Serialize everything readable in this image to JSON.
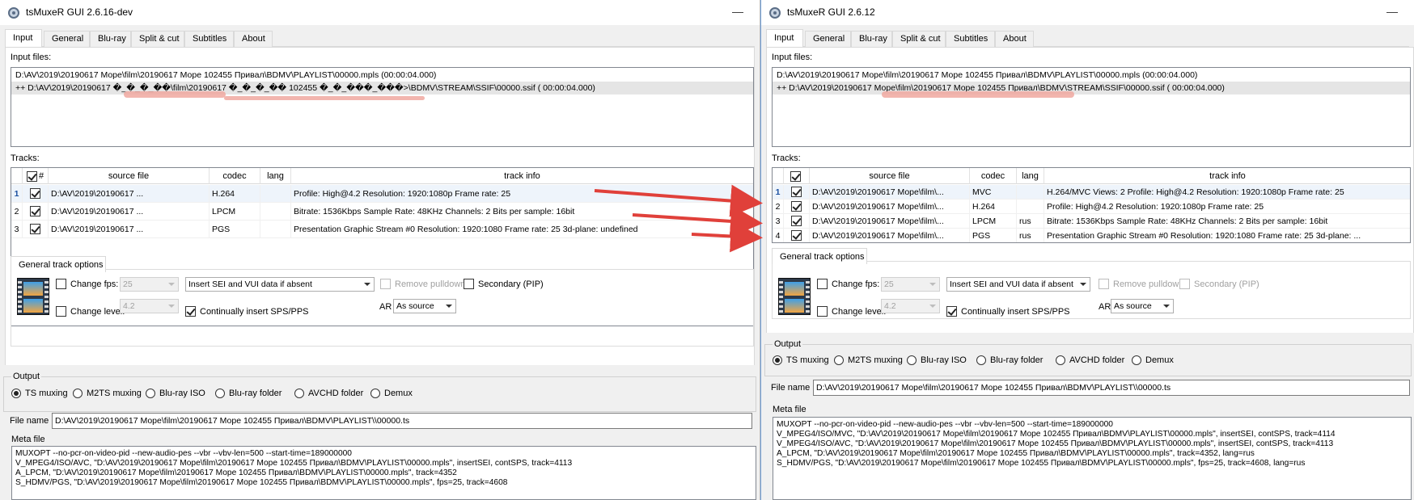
{
  "left": {
    "title": "tsMuxeR GUI 2.6.16-dev",
    "tabs": [
      "Input",
      "General",
      "Blu-ray",
      "Split & cut",
      "Subtitles",
      "About"
    ],
    "input_files_label": "Input files:",
    "input_files": [
      "D:\\AV\\2019\\20190617 Море\\film\\20190617 Море 102455 Привал\\BDMV\\PLAYLIST\\00000.mpls (00:00:04.000)",
      "++ D:\\AV\\2019\\20190617 �_�_�_��\\film\\20190617 �_�_�_�� 102455 �_�_���_���>\\BDMV\\STREAM\\SSIF\\00000.ssif ( 00:00:04.000)"
    ],
    "tracks_label": "Tracks:",
    "track_headers": {
      "check": "#",
      "source": "source file",
      "codec": "codec",
      "lang": "lang",
      "info": "track info"
    },
    "tracks": [
      {
        "num": "1",
        "source": "D:\\AV\\2019\\20190617 ...",
        "codec": "H.264",
        "lang": "",
        "info": "Profile: High@4.2  Resolution: 1920:1080p  Frame rate: 25"
      },
      {
        "num": "2",
        "source": "D:\\AV\\2019\\20190617 ...",
        "codec": "LPCM",
        "lang": "",
        "info": "Bitrate: 1536Kbps  Sample Rate: 48KHz  Channels: 2  Bits per sample: 16bit"
      },
      {
        "num": "3",
        "source": "D:\\AV\\2019\\20190617 ...",
        "codec": "PGS",
        "lang": "",
        "info": "Presentation Graphic Stream #0 Resolution: 1920:1080 Frame rate: 25   3d-plane: undefined"
      }
    ],
    "gto": {
      "title": "General track options",
      "change_fps": "Change fps:",
      "fps_value": "25",
      "sei_value": "Insert SEI and VUI data if absent",
      "remove_pulldown": "Remove pulldown",
      "secondary": "Secondary (PIP)",
      "change_level": "Change level:",
      "level_value": "4.2",
      "continually": "Continually insert SPS/PPS",
      "ar_label": "AR",
      "ar_value": "As source"
    },
    "output": {
      "title": "Output",
      "options": [
        "TS muxing",
        "M2TS muxing",
        "Blu-ray ISO",
        "Blu-ray folder",
        "AVCHD folder",
        "Demux"
      ],
      "file_name_label": "File name",
      "file_name": "D:\\AV\\2019\\20190617 Море\\film\\20190617 Море 102455 Привал\\BDMV\\PLAYLIST\\\\00000.ts"
    },
    "meta_label": "Meta file",
    "meta": [
      "MUXOPT --no-pcr-on-video-pid --new-audio-pes --vbr  --vbv-len=500 --start-time=189000000",
      "V_MPEG4/ISO/AVC, \"D:\\AV\\2019\\20190617 Море\\film\\20190617 Море 102455 Привал\\BDMV\\PLAYLIST\\00000.mpls\", insertSEI, contSPS, track=4113",
      "A_LPCM, \"D:\\AV\\2019\\20190617 Море\\film\\20190617 Море 102455 Привал\\BDMV\\PLAYLIST\\00000.mpls\", track=4352",
      "S_HDMV/PGS, \"D:\\AV\\2019\\20190617 Море\\film\\20190617 Море 102455 Привал\\BDMV\\PLAYLIST\\00000.mpls\", fps=25, track=4608"
    ]
  },
  "right": {
    "title": "tsMuxeR GUI 2.6.12",
    "tabs": [
      "Input",
      "General",
      "Blu-ray",
      "Split & cut",
      "Subtitles",
      "About"
    ],
    "input_files_label": "Input files:",
    "input_files": [
      "D:\\AV\\2019\\20190617 Море\\film\\20190617 Море 102455 Привал\\BDMV\\PLAYLIST\\00000.mpls (00:00:04.000)",
      "++ D:\\AV\\2019\\20190617 Море\\film\\20190617 Море 102455 Привал\\BDMV\\STREAM\\SSIF\\00000.ssif ( 00:00:04.000)"
    ],
    "tracks_label": "Tracks:",
    "track_headers": {
      "check": "",
      "source": "source file",
      "codec": "codec",
      "lang": "lang",
      "info": "track info"
    },
    "tracks": [
      {
        "num": "1",
        "source": "D:\\AV\\2019\\20190617 Море\\film\\...",
        "codec": "MVC",
        "lang": "",
        "info": "H.264/MVC Views: 2 Profile: High@4.2  Resolution: 1920:1080p  Frame rate: 25"
      },
      {
        "num": "2",
        "source": "D:\\AV\\2019\\20190617 Море\\film\\...",
        "codec": "H.264",
        "lang": "",
        "info": "Profile: High@4.2  Resolution: 1920:1080p  Frame rate: 25"
      },
      {
        "num": "3",
        "source": "D:\\AV\\2019\\20190617 Море\\film\\...",
        "codec": "LPCM",
        "lang": "rus",
        "info": "Bitrate: 1536Kbps  Sample Rate: 48KHz  Channels: 2  Bits per sample: 16bit"
      },
      {
        "num": "4",
        "source": "D:\\AV\\2019\\20190617 Море\\film\\...",
        "codec": "PGS",
        "lang": "rus",
        "info": "Presentation Graphic Stream #0 Resolution: 1920:1080 Frame rate: 25   3d-plane: ..."
      }
    ],
    "gto": {
      "title": "General track options",
      "change_fps": "Change fps:",
      "fps_value": "25",
      "sei_value": "Insert SEI and VUI data if absent",
      "remove_pulldown": "Remove pulldown",
      "secondary": "Secondary (PIP)",
      "change_level": "Change level:",
      "level_value": "4.2",
      "continually": "Continually insert SPS/PPS",
      "ar_label": "AR",
      "ar_value": "As source"
    },
    "output": {
      "title": "Output",
      "options": [
        "TS muxing",
        "M2TS muxing",
        "Blu-ray ISO",
        "Blu-ray folder",
        "AVCHD folder",
        "Demux"
      ],
      "file_name_label": "File name",
      "file_name": "D:\\AV\\2019\\20190617 Море\\film\\20190617 Море 102455 Привал\\BDMV\\PLAYLIST\\\\00000.ts"
    },
    "meta_label": "Meta file",
    "meta": [
      "MUXOPT --no-pcr-on-video-pid --new-audio-pes --vbr  --vbv-len=500 --start-time=189000000",
      "V_MPEG4/ISO/MVC, \"D:\\AV\\2019\\20190617 Море\\film\\20190617 Море 102455 Привал\\BDMV\\PLAYLIST\\00000.mpls\", insertSEI, contSPS, track=4114",
      "V_MPEG4/ISO/AVC, \"D:\\AV\\2019\\20190617 Море\\film\\20190617 Море 102455 Привал\\BDMV\\PLAYLIST\\00000.mpls\", insertSEI, contSPS, track=4113",
      "A_LPCM, \"D:\\AV\\2019\\20190617 Море\\film\\20190617 Море 102455 Привал\\BDMV\\PLAYLIST\\00000.mpls\", track=4352, lang=rus",
      "S_HDMV/PGS, \"D:\\AV\\2019\\20190617 Море\\film\\20190617 Море 102455 Привал\\BDMV\\PLAYLIST\\00000.mpls\", fps=25, track=4608, lang=rus"
    ]
  },
  "colors": {
    "annotation_arrow": "#e0403a",
    "highlight_scribble": "#f0a8a0",
    "window_bg": "#f0f0f0",
    "selected_row": "#e5e5e5"
  },
  "icons": {
    "app": "tsmuxer-icon",
    "track_options": "film-strip-icon",
    "minimize": "minimize-icon"
  }
}
